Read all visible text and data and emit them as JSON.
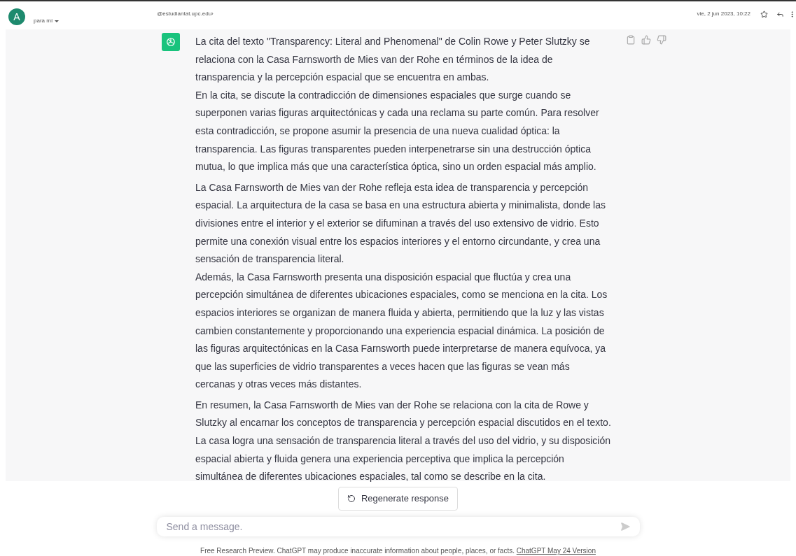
{
  "email_header": {
    "avatar_letter": "A",
    "recipient": "para mí",
    "sender": "@estudiantat.upc.edu›",
    "date": "vie, 2 jun 2023, 10:22"
  },
  "message": {
    "paragraphs": [
      "La cita del texto \"Transparency: Literal and Phenomenal\" de Colin Rowe y Peter Slutzky se relaciona con la Casa Farnsworth de Mies van der Rohe en términos de la idea de transparencia y la percepción espacial que se encuentra en ambas.",
      "En la cita, se discute la contradicción de dimensiones espaciales que surge cuando se superponen varias figuras arquitectónicas y cada una reclama su parte común. Para resolver esta contradicción, se propone asumir la presencia de una nueva cualidad óptica: la transparencia. Las figuras transparentes pueden interpenetrarse sin una destrucción óptica mutua, lo que implica más que una característica óptica, sino un orden espacial más amplio.",
      "La Casa Farnsworth de Mies van der Rohe refleja esta idea de transparencia y percepción espacial. La arquitectura de la casa se basa en una estructura abierta y minimalista, donde las divisiones entre el interior y el exterior se difuminan a través del uso extensivo de vidrio. Esto permite una conexión visual entre los espacios interiores y el entorno circundante, y crea una sensación de transparencia literal.",
      "Además, la Casa Farnsworth presenta una disposición espacial que fluctúa y crea una percepción simultánea de diferentes ubicaciones espaciales, como se menciona en la cita. Los espacios interiores se organizan de manera fluida y abierta, permitiendo que la luz y las vistas cambien constantemente y proporcionando una experiencia espacial dinámica. La posición de las figuras arquitectónicas en la Casa Farnsworth puede interpretarse de manera equívoca, ya que las superficies de vidrio transparentes a veces hacen que las figuras se vean más cercanas y otras veces más distantes.",
      "En resumen, la Casa Farnsworth de Mies van der Rohe se relaciona con la cita de Rowe y Slutzky al encarnar los conceptos de transparencia y percepción espacial discutidos en el texto. La casa logra una sensación de transparencia literal a través del uso del vidrio, y su disposición espacial abierta y fluida genera una experiencia perceptiva que implica la percepción simultánea de diferentes ubicaciones espaciales, tal como se describe en la cita."
    ]
  },
  "regenerate_button": "Regenerate response",
  "composer": {
    "placeholder": "Send a message."
  },
  "footer": {
    "text": "Free Research Preview. ChatGPT may produce inaccurate information about people, places, or facts.",
    "link": "ChatGPT May 24 Version"
  }
}
